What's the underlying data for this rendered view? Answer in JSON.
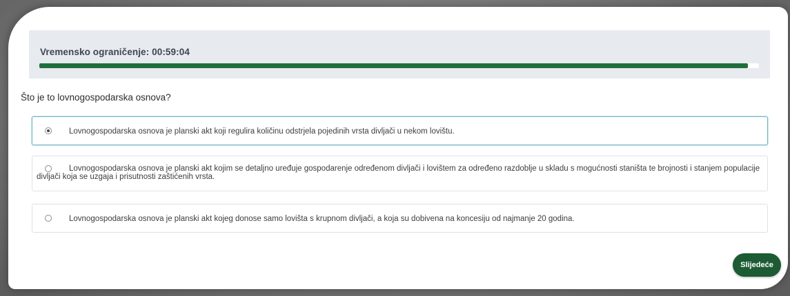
{
  "timer": {
    "label": "Vremensko ograničenje: 00:59:04",
    "progress_fraction": 0.985,
    "bar_color": "#1f6f3c"
  },
  "question": {
    "text": "Što je to lovnogospodarska osnova?"
  },
  "options": [
    {
      "label": "Lovnogospodarska osnova je planski akt koji regulira količinu odstrjela pojedinih vrsta divljači u nekom lovištu.",
      "selected": true
    },
    {
      "label": "Lovnogospodarska osnova je planski akt kojim se detaljno uređuje gospodarenje određenom divljači i lovištem za određeno razdoblje u skladu s mogućnosti staništa te brojnosti i stanjem populacije divljači koja se uzgaja i prisutnosti zaštićenih vrsta.",
      "selected": false
    },
    {
      "label": "Lovnogospodarska osnova je planski akt kojeg donose samo lovišta s krupnom divljači, a koja su dobivena na koncesiju od najmanje 20 godina.",
      "selected": false
    }
  ],
  "next_button": {
    "label": "Slijedeće",
    "color": "#1c5b33"
  }
}
